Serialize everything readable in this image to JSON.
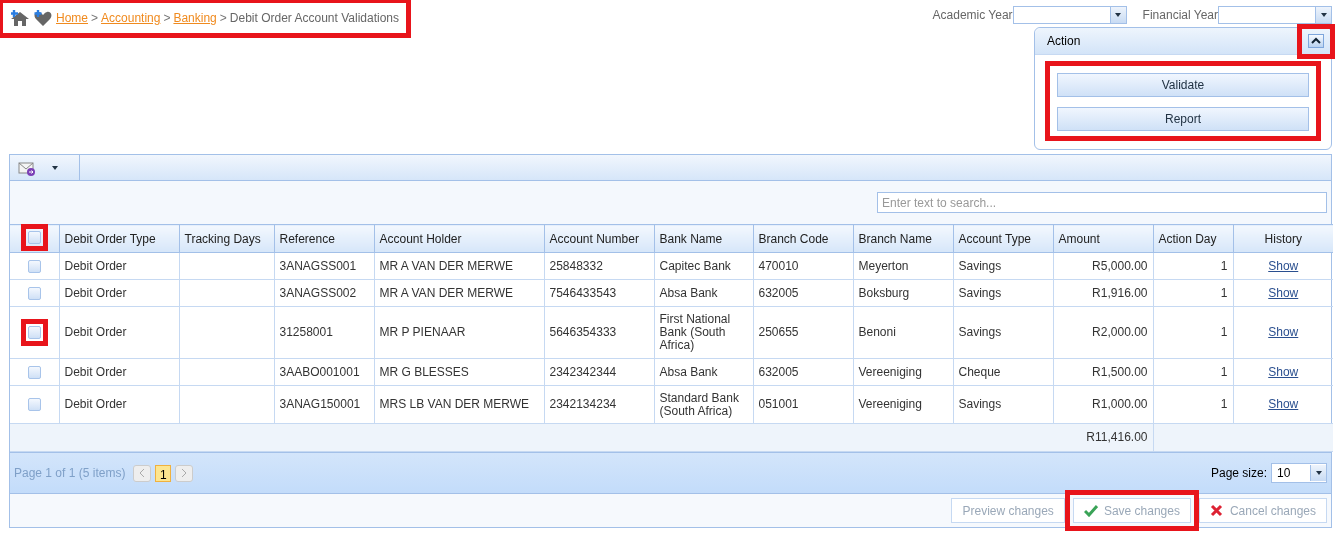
{
  "breadcrumb": {
    "highlighted": true,
    "links": [
      "Home",
      "Accounting",
      "Banking"
    ],
    "separator": ">",
    "current": "Debit Order Account Validations"
  },
  "filters": [
    {
      "label": "Academic Year"
    },
    {
      "label": "Financial Year"
    }
  ],
  "action_panel": {
    "title": "Action",
    "expanded": true,
    "collapse_highlighted": true,
    "buttons_highlighted": true,
    "buttons": [
      "Validate",
      "Report"
    ]
  },
  "grid": {
    "search": {
      "placeholder": "Enter text to search..."
    },
    "select_all": {
      "checked": false,
      "highlighted": true
    },
    "columns": [
      "Debit Order Type",
      "Tracking Days",
      "Reference",
      "Account Holder",
      "Account Number",
      "Bank Name",
      "Branch Code",
      "Branch Name",
      "Account Type",
      "Amount",
      "Action Day",
      "History"
    ],
    "rows": [
      {
        "checked": false,
        "highlighted": false,
        "cells": [
          "Debit Order",
          "",
          "3ANAGSS001",
          "MR A VAN DER MERWE",
          "25848332",
          "Capitec Bank",
          "470010",
          "Meyerton",
          "Savings",
          "R5,000.00",
          "1",
          "Show"
        ]
      },
      {
        "checked": false,
        "highlighted": false,
        "cells": [
          "Debit Order",
          "",
          "3ANAGSS002",
          "MR A VAN DER MERWE",
          "7546433543",
          "Absa Bank",
          "632005",
          "Boksburg",
          "Savings",
          "R1,916.00",
          "1",
          "Show"
        ]
      },
      {
        "checked": false,
        "highlighted": true,
        "cells": [
          "Debit Order",
          "",
          "31258001",
          "MR P PIENAAR",
          "5646354333",
          "First National Bank (South Africa)",
          "250655",
          "Benoni",
          "Savings",
          "R2,000.00",
          "1",
          "Show"
        ]
      },
      {
        "checked": false,
        "highlighted": false,
        "cells": [
          "Debit Order",
          "",
          "3AABO001001",
          "MR G BLESSES",
          "2342342344",
          "Absa Bank",
          "632005",
          "Vereeniging",
          "Cheque",
          "R1,500.00",
          "1",
          "Show"
        ]
      },
      {
        "checked": false,
        "highlighted": false,
        "cells": [
          "Debit Order",
          "",
          "3ANAG150001",
          "MRS LB VAN DER MERWE",
          "2342134234",
          "Standard Bank (South Africa)",
          "051001",
          "Vereeniging",
          "Savings",
          "R1,000.00",
          "1",
          "Show"
        ]
      }
    ],
    "total": "R11,416.00",
    "pager": {
      "summary": "Page 1 of 1 (5 items)",
      "pages": [
        {
          "label": "1",
          "selected": true
        }
      ],
      "page_size_label": "Page size:",
      "page_size": "10"
    },
    "footer_buttons": [
      {
        "kind": "preview",
        "label": "Preview changes",
        "highlighted": false
      },
      {
        "kind": "save",
        "label": "Save changes",
        "highlighted": true
      },
      {
        "kind": "cancel",
        "label": "Cancel changes",
        "highlighted": false
      }
    ]
  }
}
